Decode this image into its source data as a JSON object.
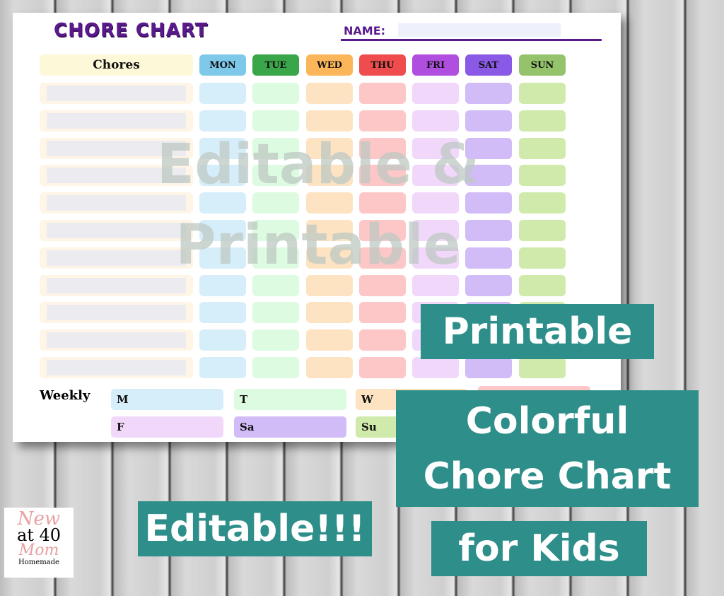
{
  "chart": {
    "title": "CHORE CHART",
    "name_label": "NAME:",
    "name_value": "",
    "chores_header": "Chores",
    "days": [
      {
        "label": "MON",
        "color": "#7ec8ea",
        "light": "#d6eefa"
      },
      {
        "label": "TUE",
        "color": "#3aa64a",
        "light": "#dcfbe0"
      },
      {
        "label": "WED",
        "color": "#fbb659",
        "light": "#fde3c2"
      },
      {
        "label": "THU",
        "color": "#ef4d4d",
        "light": "#fdc7c7"
      },
      {
        "label": "FRI",
        "color": "#b04ee0",
        "light": "#f1d8fb"
      },
      {
        "label": "SAT",
        "color": "#8a5ae6",
        "light": "#d1bcf8"
      },
      {
        "label": "SUN",
        "color": "#95c36b",
        "light": "#cfeaaa"
      }
    ],
    "row_count": 11,
    "weekly_label": "Weekly",
    "weekly": [
      {
        "label": "M",
        "color": "#d6eefa"
      },
      {
        "label": "T",
        "color": "#dcfbe0"
      },
      {
        "label": "W",
        "color": "#fde3c2"
      },
      {
        "label": "",
        "color": "#fdc7c7"
      },
      {
        "label": "F",
        "color": "#f1d8fb"
      },
      {
        "label": "Sa",
        "color": "#d1bcf8"
      },
      {
        "label": "Su",
        "color": "#cfeaaa"
      }
    ]
  },
  "watermark": [
    "Editable &",
    "Printable"
  ],
  "banners": {
    "printable": "Printable",
    "colorful": "Colorful",
    "chore_chart": "Chore Chart",
    "for_kids": "for Kids",
    "editable": "Editable!!!"
  },
  "logo": {
    "line1": "New",
    "line2": "at 40",
    "line3": "Mom",
    "line4": "Homemade"
  },
  "colors": {
    "teal": "#2e8e8a",
    "purple": "#5a1a8c"
  }
}
